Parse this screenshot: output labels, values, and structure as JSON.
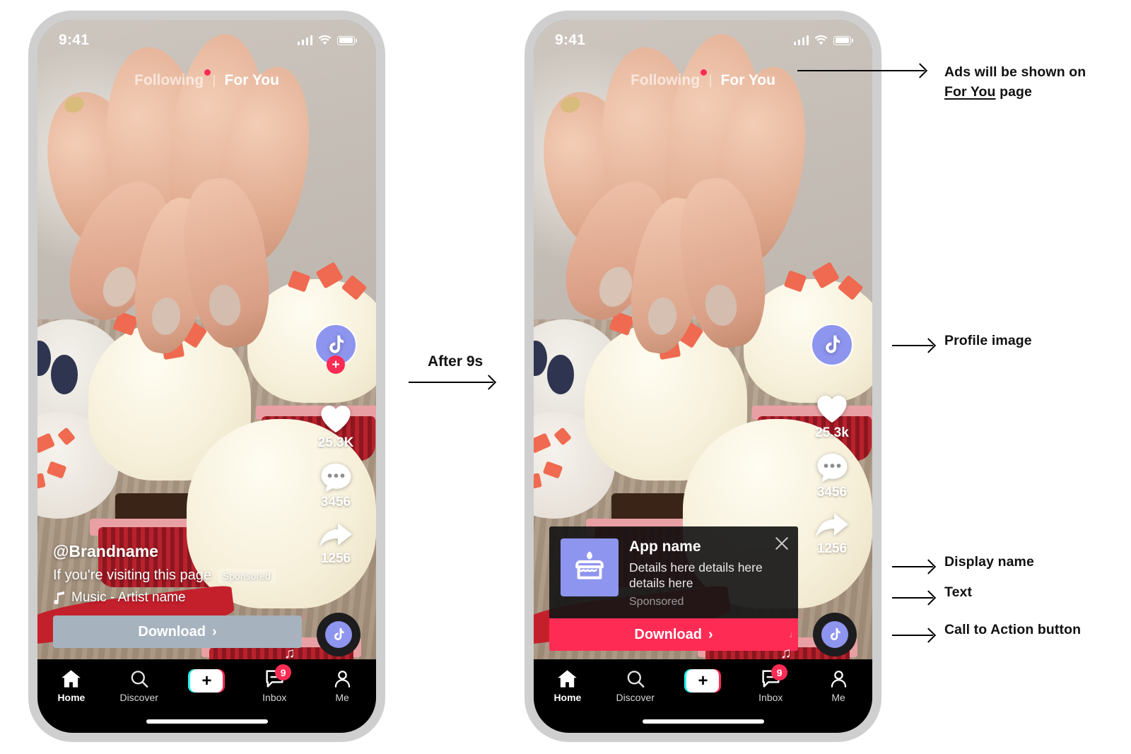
{
  "status_bar": {
    "time": "9:41",
    "signal_icon": "cellular-bars-icon",
    "wifi_icon": "wifi-icon",
    "battery_icon": "battery-icon"
  },
  "tabs": {
    "following": "Following",
    "for_you": "For You"
  },
  "rail": {
    "profile_icon": "tiktok-note-icon",
    "follow_plus": "+",
    "like_icon": "heart-icon",
    "like_count_1": "25.3K",
    "like_count_2": "25.3k",
    "comment_icon": "comment-bubble-icon",
    "comment_count": "3456",
    "share_icon": "share-arrow-icon",
    "share_count": "1256"
  },
  "caption": {
    "username": "@Brandname",
    "text": "If you're visiting this page",
    "sponsored_badge": "Sponsored",
    "music_icon": "music-note-icon",
    "music": "Music - Artist name",
    "cta_label": "Download",
    "cta_chevron": "›"
  },
  "ad_card": {
    "app_icon": "birthday-cake-icon",
    "app_name": "App name",
    "details": "Details here details here details here",
    "sponsored": "Sponsored",
    "cta_label": "Download",
    "cta_chevron": "›",
    "close_icon": "close-x-icon"
  },
  "nav": {
    "items": [
      {
        "label": "Home",
        "icon": "home-icon",
        "active": true
      },
      {
        "label": "Discover",
        "icon": "search-icon",
        "active": false
      },
      {
        "label": "",
        "icon": "add-post-icon",
        "active": false
      },
      {
        "label": "Inbox",
        "icon": "inbox-message-icon",
        "badge": "9",
        "active": false
      },
      {
        "label": "Me",
        "icon": "person-icon",
        "active": false
      }
    ]
  },
  "transition": {
    "label": "After 9s"
  },
  "annotations": [
    {
      "id": "for-you",
      "line1": "Ads will be shown on",
      "line2_underline": "For You",
      "line2_rest": " page"
    },
    {
      "id": "profile-image",
      "text": "Profile image"
    },
    {
      "id": "display-name",
      "text": "Display name"
    },
    {
      "id": "text",
      "text": "Text"
    },
    {
      "id": "cta",
      "text": "Call to Action button"
    }
  ],
  "colors": {
    "accent_pink": "#fe2c55",
    "accent_cyan": "#25f4ee",
    "app_icon_purple": "#8e95ee",
    "flat_cta_gray": "#a6b3bf",
    "phone_bezel": "#cfcfcf"
  }
}
